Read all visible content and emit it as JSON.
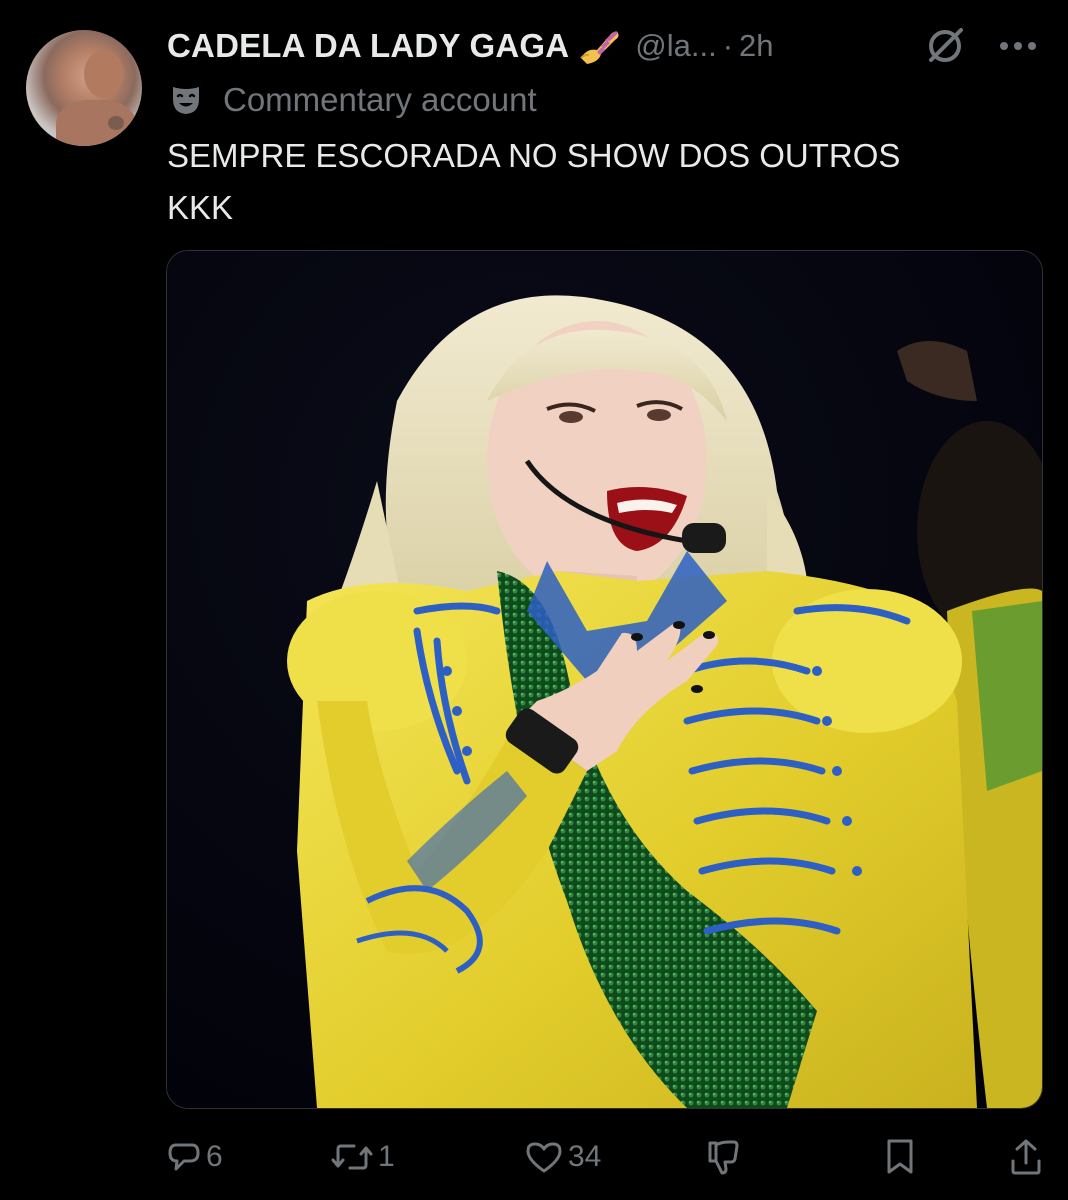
{
  "post": {
    "author": {
      "display_name": "CADELA DA LADY GAGA",
      "name_emoji": "nail-polish-icon",
      "handle": "@la...",
      "separator": "·",
      "time": "2h",
      "label": "Commentary account",
      "label_icon": "theater-mask-icon"
    },
    "text_lines": [
      "SEMPRE ESCORADA NO SHOW DOS OUTROS",
      "KKK"
    ]
  },
  "actions": {
    "reply": {
      "icon": "reply-icon",
      "count": "6"
    },
    "repost": {
      "icon": "repost-icon",
      "count": "1"
    },
    "like": {
      "icon": "like-icon",
      "count": "34"
    },
    "dislike": {
      "icon": "dislike-icon"
    },
    "bookmark": {
      "icon": "bookmark-icon"
    },
    "share": {
      "icon": "share-icon"
    }
  },
  "colors": {
    "background": "#000000",
    "primary_text": "#e7e9ea",
    "secondary_text": "#71767b",
    "border": "#2f3336",
    "jacket_yellow": "#e8d43a",
    "embroidery_blue": "#2d5fc4",
    "sequin_green": "#1f6b2e"
  }
}
